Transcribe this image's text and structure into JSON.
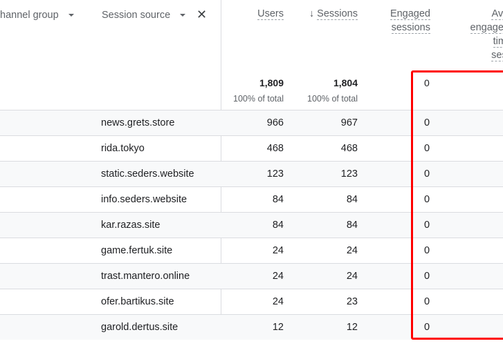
{
  "dimensions": {
    "primary_label": "hannel group",
    "secondary_label": "Session source",
    "remove_icon": "close-icon"
  },
  "metrics": {
    "users": {
      "label": "Users",
      "total": "1,809",
      "pct": "100% of total"
    },
    "sessions": {
      "label": "Sessions",
      "sort": "descending",
      "total": "1,804",
      "pct": "100% of total"
    },
    "engaged": {
      "label_line1": "Engaged",
      "label_line2": "sessions",
      "total": "0"
    },
    "avg": {
      "line1": "Aver",
      "line2": "engagem",
      "line3": "time",
      "line4": "sess"
    }
  },
  "rows": [
    {
      "source": "news.grets.store",
      "users": "966",
      "sessions": "967",
      "engaged": "0"
    },
    {
      "source": "rida.tokyo",
      "users": "468",
      "sessions": "468",
      "engaged": "0"
    },
    {
      "source": "static.seders.website",
      "users": "123",
      "sessions": "123",
      "engaged": "0"
    },
    {
      "source": "info.seders.website",
      "users": "84",
      "sessions": "84",
      "engaged": "0"
    },
    {
      "source": "kar.razas.site",
      "users": "84",
      "sessions": "84",
      "engaged": "0"
    },
    {
      "source": "game.fertuk.site",
      "users": "24",
      "sessions": "24",
      "engaged": "0"
    },
    {
      "source": "trast.mantero.online",
      "users": "24",
      "sessions": "24",
      "engaged": "0"
    },
    {
      "source": "ofer.bartikus.site",
      "users": "24",
      "sessions": "23",
      "engaged": "0"
    },
    {
      "source": "garold.dertus.site",
      "users": "12",
      "sessions": "12",
      "engaged": "0"
    }
  ],
  "highlight_color": "#ff0000"
}
